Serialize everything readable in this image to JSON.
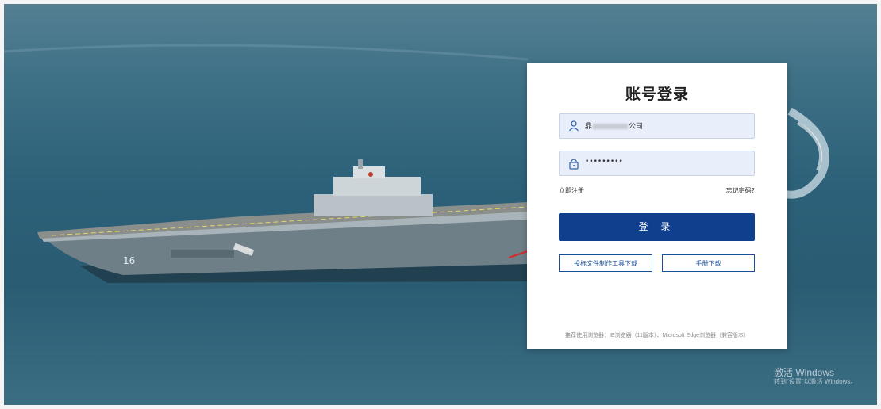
{
  "login": {
    "title": "账号登录",
    "username_prefix": "鼎",
    "username_suffix": "公司",
    "password_masked": "•••••••••",
    "register_link": "立即注册",
    "forgot_link": "忘记密码?",
    "login_button": "登 录",
    "tool_download_button": "投标文件制作工具下载",
    "manual_download_button": "手册下载",
    "browser_note": "推荐使用浏览器：IE浏览器（11版本）、Microsoft Edge浏览器（兼容版本）"
  },
  "watermark": {
    "line1": "激活 Windows",
    "line2": "转到\"设置\"以激活 Windows。"
  },
  "icons": {
    "user": "user-icon",
    "lock": "lock-icon"
  },
  "colors": {
    "primary": "#0f3f8d",
    "field_bg": "#e8eefa",
    "arrow": "#d42a2a"
  }
}
